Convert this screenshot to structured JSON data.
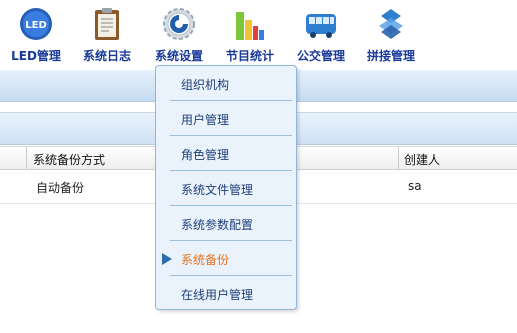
{
  "toolbar": {
    "items": [
      {
        "label": "LED管理",
        "icon": "led-icon"
      },
      {
        "label": "系统日志",
        "icon": "clipboard-icon"
      },
      {
        "label": "系统设置",
        "icon": "gear-icon"
      },
      {
        "label": "节目统计",
        "icon": "bar-chart-icon"
      },
      {
        "label": "公交管理",
        "icon": "bus-icon"
      },
      {
        "label": "拼接管理",
        "icon": "splice-icon"
      }
    ]
  },
  "menu": {
    "items": [
      {
        "label": "组织机构"
      },
      {
        "label": "用户管理"
      },
      {
        "label": "角色管理"
      },
      {
        "label": "系统文件管理"
      },
      {
        "label": "系统参数配置"
      },
      {
        "label": "系统备份",
        "active": true
      },
      {
        "label": "在线用户管理"
      }
    ],
    "active_color": "#e8731e"
  },
  "table": {
    "columns": [
      "系统备份方式",
      "创建人"
    ],
    "rows": [
      [
        "自动备份",
        "sa"
      ]
    ]
  }
}
